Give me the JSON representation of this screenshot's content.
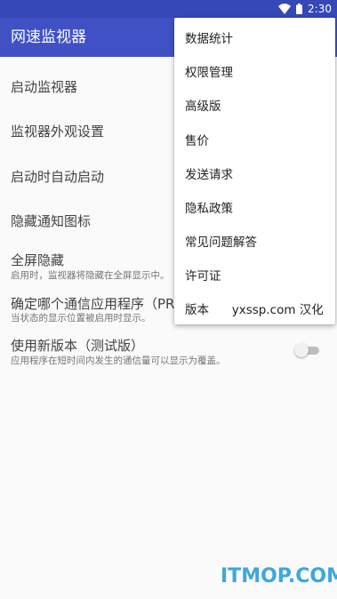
{
  "status_bar": {
    "time": "2:30",
    "icons": [
      "wifi-icon",
      "battery-icon"
    ]
  },
  "app_bar": {
    "title": "网速监视器",
    "color": "#3f51c5"
  },
  "settings": [
    {
      "title": "启动监视器"
    },
    {
      "title": "监视器外观设置"
    },
    {
      "title": "启动时自动启动"
    },
    {
      "title": "隐藏通知图标"
    },
    {
      "title": "全屏隐藏",
      "subtitle": "启用时，监视器将隐藏在全屏显示中。"
    },
    {
      "title": "确定哪个通信应用程序（PRO",
      "subtitle": "当状态的显示位置被启用时显示。"
    },
    {
      "title": "使用新版本（测试版）",
      "subtitle": "应用程序在短时间内发生的通信量可以显示为覆盖。",
      "toggle": "off"
    }
  ],
  "menu": {
    "items": [
      "数据统计",
      "权限管理",
      "高级版",
      "售价",
      "发送请求",
      "隐私政策",
      "常见问题解答",
      "许可证",
      "版本      yxssp.com 汉化"
    ]
  },
  "watermark": "ITMOP.COM"
}
